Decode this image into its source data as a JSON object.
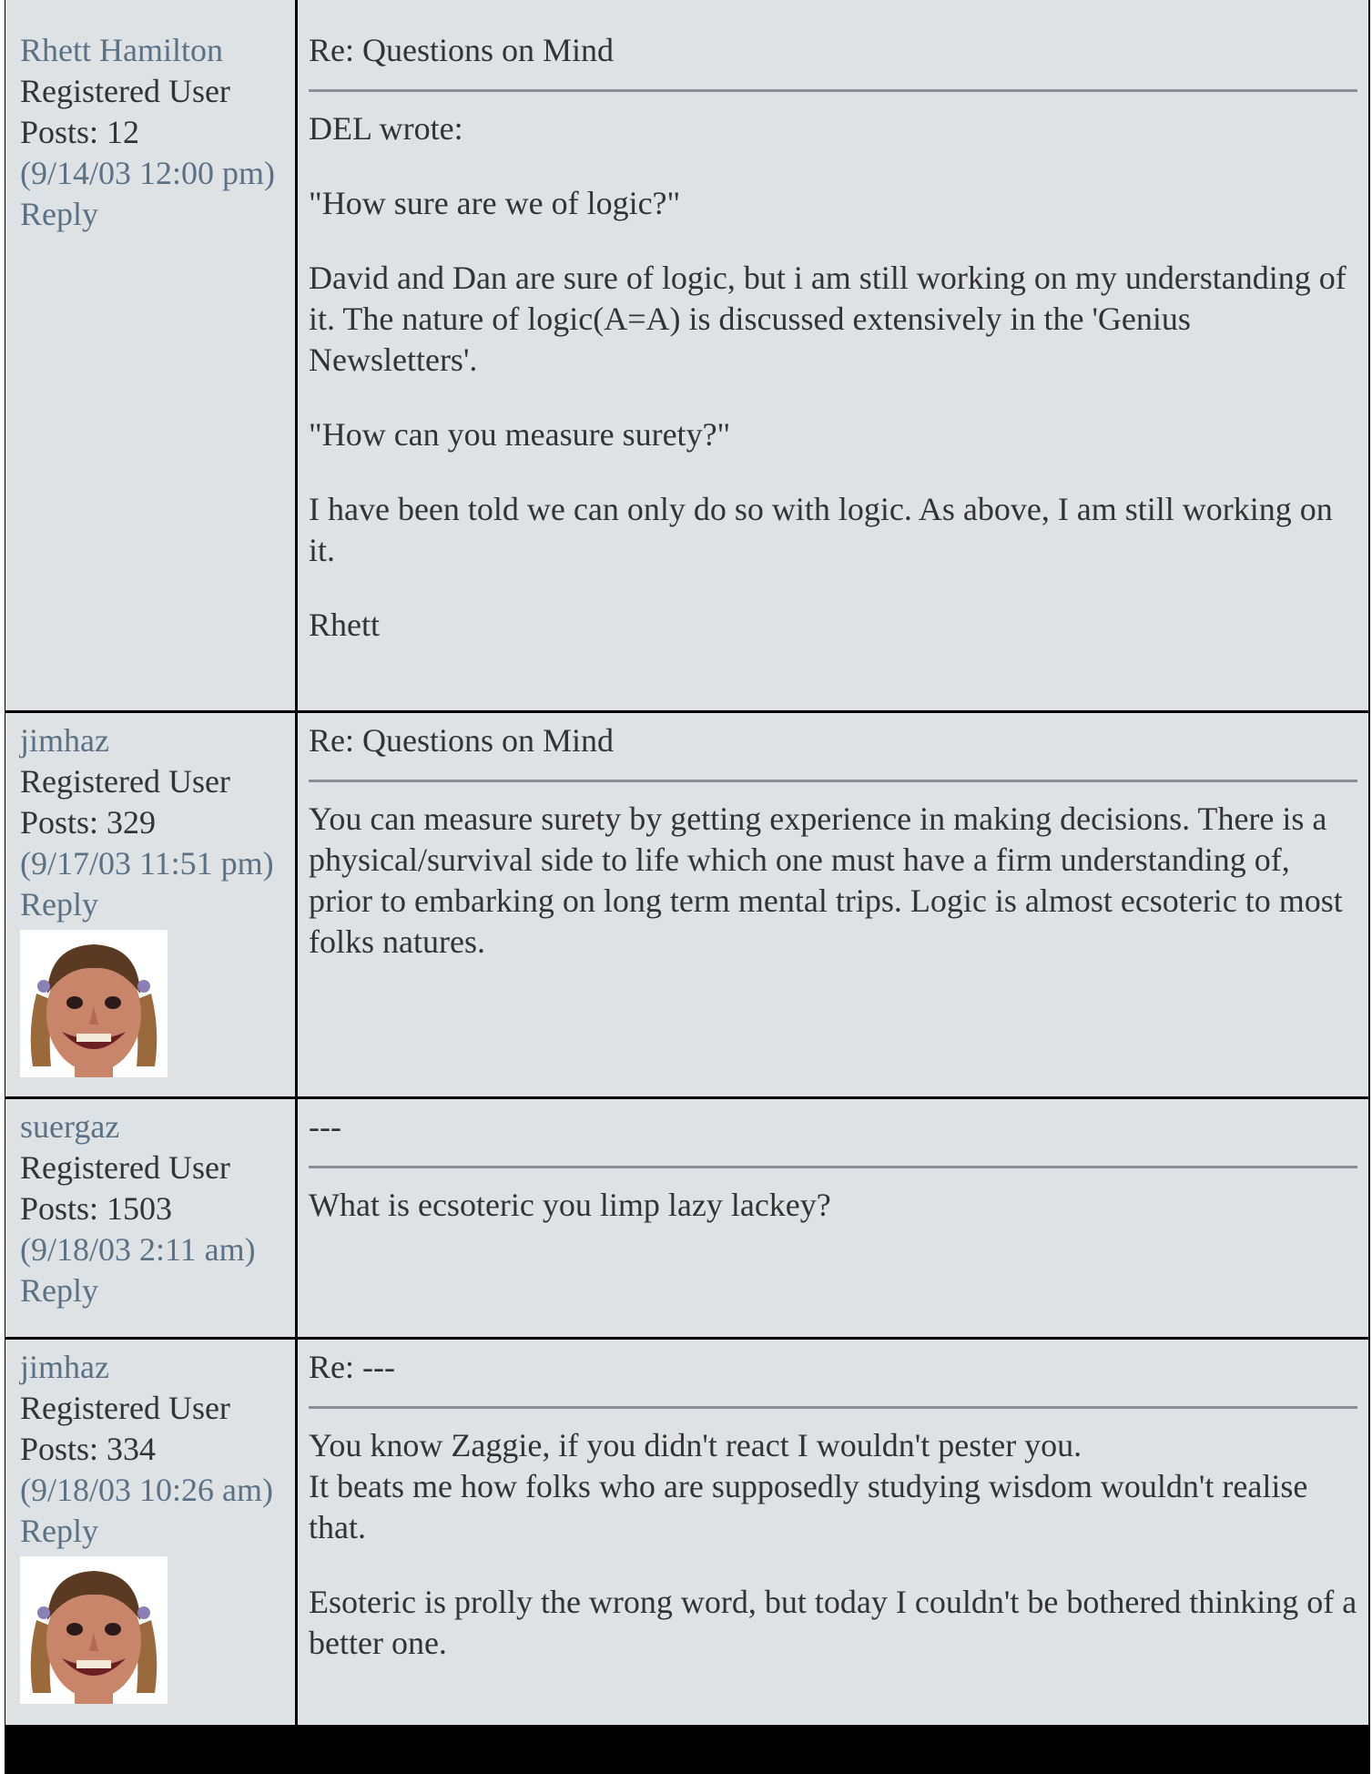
{
  "posts": [
    {
      "author": "Rhett Hamilton",
      "rank": "Registered User",
      "post_count": "Posts: 12",
      "date": "(9/14/03 12:00 pm)",
      "reply_label": "Reply",
      "has_avatar": false,
      "subject": "Re: Questions on Mind",
      "body": [
        "DEL wrote:",
        "\"How sure are we of logic?\"",
        "David and Dan are sure of logic, but i am still working on my understanding of it. The nature of logic(A=A) is discussed extensively in the 'Genius Newsletters'.",
        "\"How can you measure surety?\"",
        "I have been told we can only do so with logic. As above, I am still working on it.",
        "Rhett"
      ]
    },
    {
      "author": "jimhaz",
      "rank": "Registered User",
      "post_count": "Posts: 329",
      "date": "(9/17/03 11:51 pm)",
      "reply_label": "Reply",
      "has_avatar": true,
      "subject": "Re: Questions on Mind",
      "body": [
        "You can measure surety by getting experience in making decisions. There is a physical/survival side to life which one must have a firm understanding of, prior to embarking on long term mental trips. Logic is almost ecsoteric to most folks natures."
      ]
    },
    {
      "author": "suergaz",
      "rank": "Registered User",
      "post_count": "Posts: 1503",
      "date": "(9/18/03 2:11 am)",
      "reply_label": "Reply",
      "has_avatar": false,
      "subject": "---",
      "body": [
        "What is ecsoteric you limp lazy lackey?"
      ]
    },
    {
      "author": "jimhaz",
      "rank": "Registered User",
      "post_count": "Posts: 334",
      "date": "(9/18/03 10:26 am)",
      "reply_label": "Reply",
      "has_avatar": true,
      "subject": "Re: ---",
      "body": [
        "You know Zaggie, if you didn't react I wouldn't pester you.\nIt beats me how folks who are supposedly studying wisdom wouldn't realise that.",
        "Esoteric is prolly the wrong word, but today I couldn't be bothered thinking of a better one."
      ]
    }
  ],
  "colors": {
    "cell_bg": "#dfe2e5",
    "link": "#5b7185",
    "text": "#333333",
    "border": "#000000"
  }
}
